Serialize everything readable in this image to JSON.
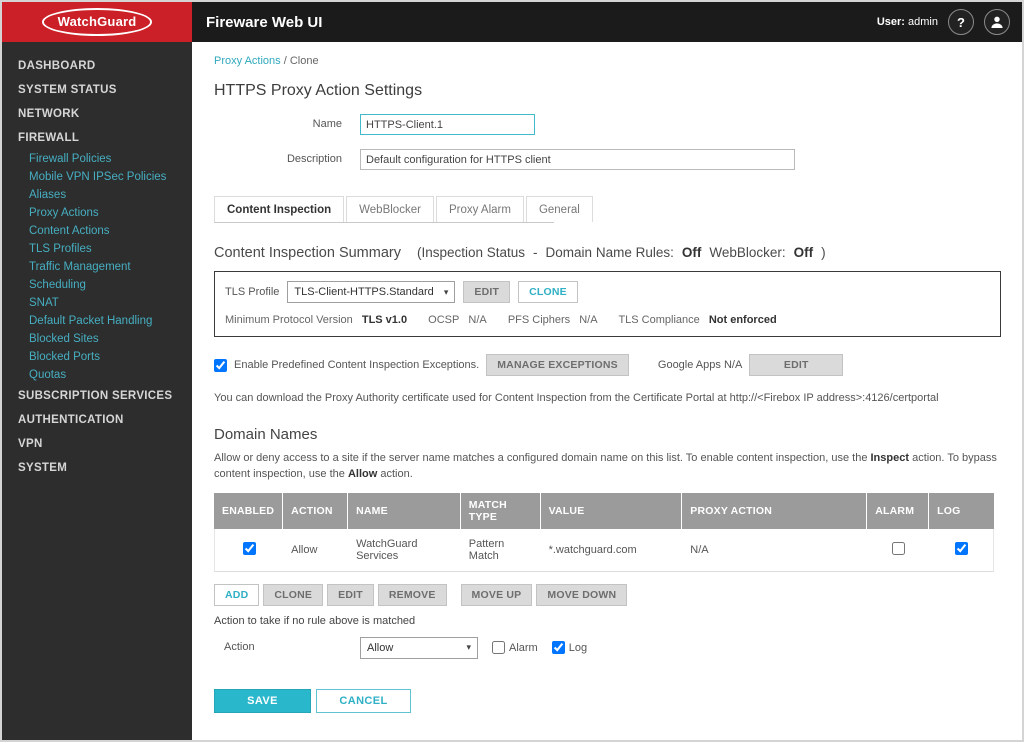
{
  "icons": {
    "help": "?",
    "caret": "▾"
  },
  "header": {
    "logo_text": "WatchGuard",
    "app_title": "Fireware Web UI",
    "user_label": "User:",
    "user_name": "admin"
  },
  "sidebar": {
    "sections_top": [
      "DASHBOARD",
      "SYSTEM STATUS",
      "NETWORK",
      "FIREWALL"
    ],
    "firewall_items": [
      "Firewall Policies",
      "Mobile VPN IPSec Policies",
      "Aliases",
      "Proxy Actions",
      "Content Actions",
      "TLS Profiles",
      "Traffic Management",
      "Scheduling",
      "SNAT",
      "Default Packet Handling",
      "Blocked Sites",
      "Blocked Ports",
      "Quotas"
    ],
    "sections_bottom": [
      "SUBSCRIPTION SERVICES",
      "AUTHENTICATION",
      "VPN",
      "SYSTEM"
    ]
  },
  "breadcrumb": {
    "link": "Proxy Actions",
    "separator": "/",
    "current": "Clone"
  },
  "page": {
    "title": "HTTPS Proxy Action Settings"
  },
  "form": {
    "name_label": "Name",
    "name_value": "HTTPS-Client.1",
    "description_label": "Description",
    "description_value": "Default configuration for HTTPS client"
  },
  "tabs": [
    {
      "label": "Content Inspection"
    },
    {
      "label": "WebBlocker"
    },
    {
      "label": "Proxy Alarm"
    },
    {
      "label": "General"
    }
  ],
  "summary": {
    "title": "Content Inspection Summary",
    "paren_open": "(Inspection Status",
    "dash": "-",
    "rules_label": "Domain Name Rules:",
    "rules_value": "Off",
    "webblocker_label": "WebBlocker:",
    "webblocker_value": "Off",
    "paren_close": ")"
  },
  "tls": {
    "profile_label": "TLS Profile",
    "profile_value": "TLS-Client-HTTPS.Standard",
    "edit_button": "EDIT",
    "clone_button": "CLONE",
    "min_proto_label": "Minimum Protocol Version",
    "min_proto_value": "TLS v1.0",
    "ocsp_label": "OCSP",
    "ocsp_value": "N/A",
    "pfs_label": "PFS Ciphers",
    "pfs_value": "N/A",
    "compliance_label": "TLS Compliance",
    "compliance_value": "Not enforced"
  },
  "exceptions": {
    "checkbox_checked": true,
    "label": "Enable Predefined Content Inspection Exceptions.",
    "manage_button": "MANAGE EXCEPTIONS",
    "google_apps_label": "Google Apps N/A",
    "edit_button": "EDIT"
  },
  "cert_note": "You can download the Proxy Authority certificate used for Content Inspection from the Certificate Portal at http://<Firebox IP address>:4126/certportal",
  "domain_names": {
    "title": "Domain Names",
    "desc_part1": "Allow or deny access to a site if the server name matches a configured domain name on this list. To enable content inspection, use the ",
    "desc_bold1": "Inspect",
    "desc_part2": " action. To bypass content inspection, use the ",
    "desc_bold2": "Allow",
    "desc_part3": " action.",
    "table": {
      "headers": [
        "ENABLED",
        "ACTION",
        "NAME",
        "MATCH TYPE",
        "VALUE",
        "PROXY ACTION",
        "ALARM",
        "LOG"
      ],
      "row": {
        "enabled": true,
        "action": "Allow",
        "name": "WatchGuard Services",
        "match_type": "Pattern Match",
        "value": "*.watchguard.com",
        "proxy_action": "N/A",
        "alarm": false,
        "log": true
      }
    },
    "buttons": {
      "add": "ADD",
      "clone": "CLONE",
      "edit": "EDIT",
      "remove": "REMOVE",
      "move_up": "MOVE UP",
      "move_down": "MOVE DOWN"
    },
    "no_rule_text": "Action to take if no rule above is matched",
    "action_label": "Action",
    "action_value": "Allow",
    "alarm_label": "Alarm",
    "alarm_checked": false,
    "log_label": "Log",
    "log_checked": true
  },
  "footer": {
    "save": "SAVE",
    "cancel": "CANCEL"
  }
}
